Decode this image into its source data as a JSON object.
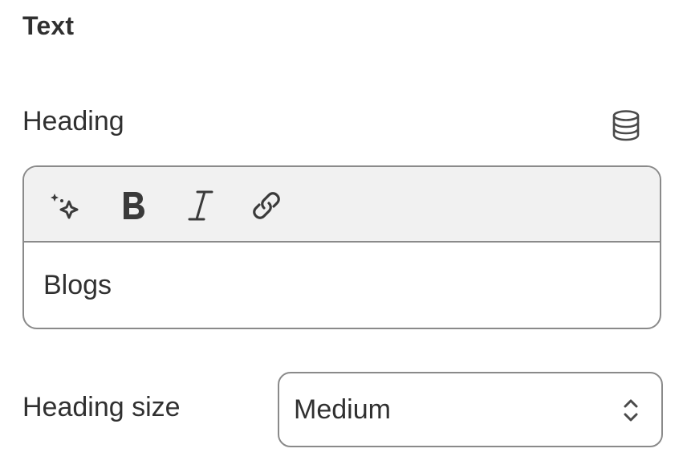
{
  "section": {
    "title": "Text"
  },
  "heading_field": {
    "label": "Heading",
    "dynamic_source_icon": "database-icon",
    "toolbar": [
      {
        "name": "magic-sparkle-icon"
      },
      {
        "name": "bold-icon"
      },
      {
        "name": "italic-icon"
      },
      {
        "name": "link-icon"
      }
    ],
    "value": "Blogs"
  },
  "heading_size": {
    "label": "Heading size",
    "selected": "Medium",
    "icon": "select-chevrons-icon"
  }
}
